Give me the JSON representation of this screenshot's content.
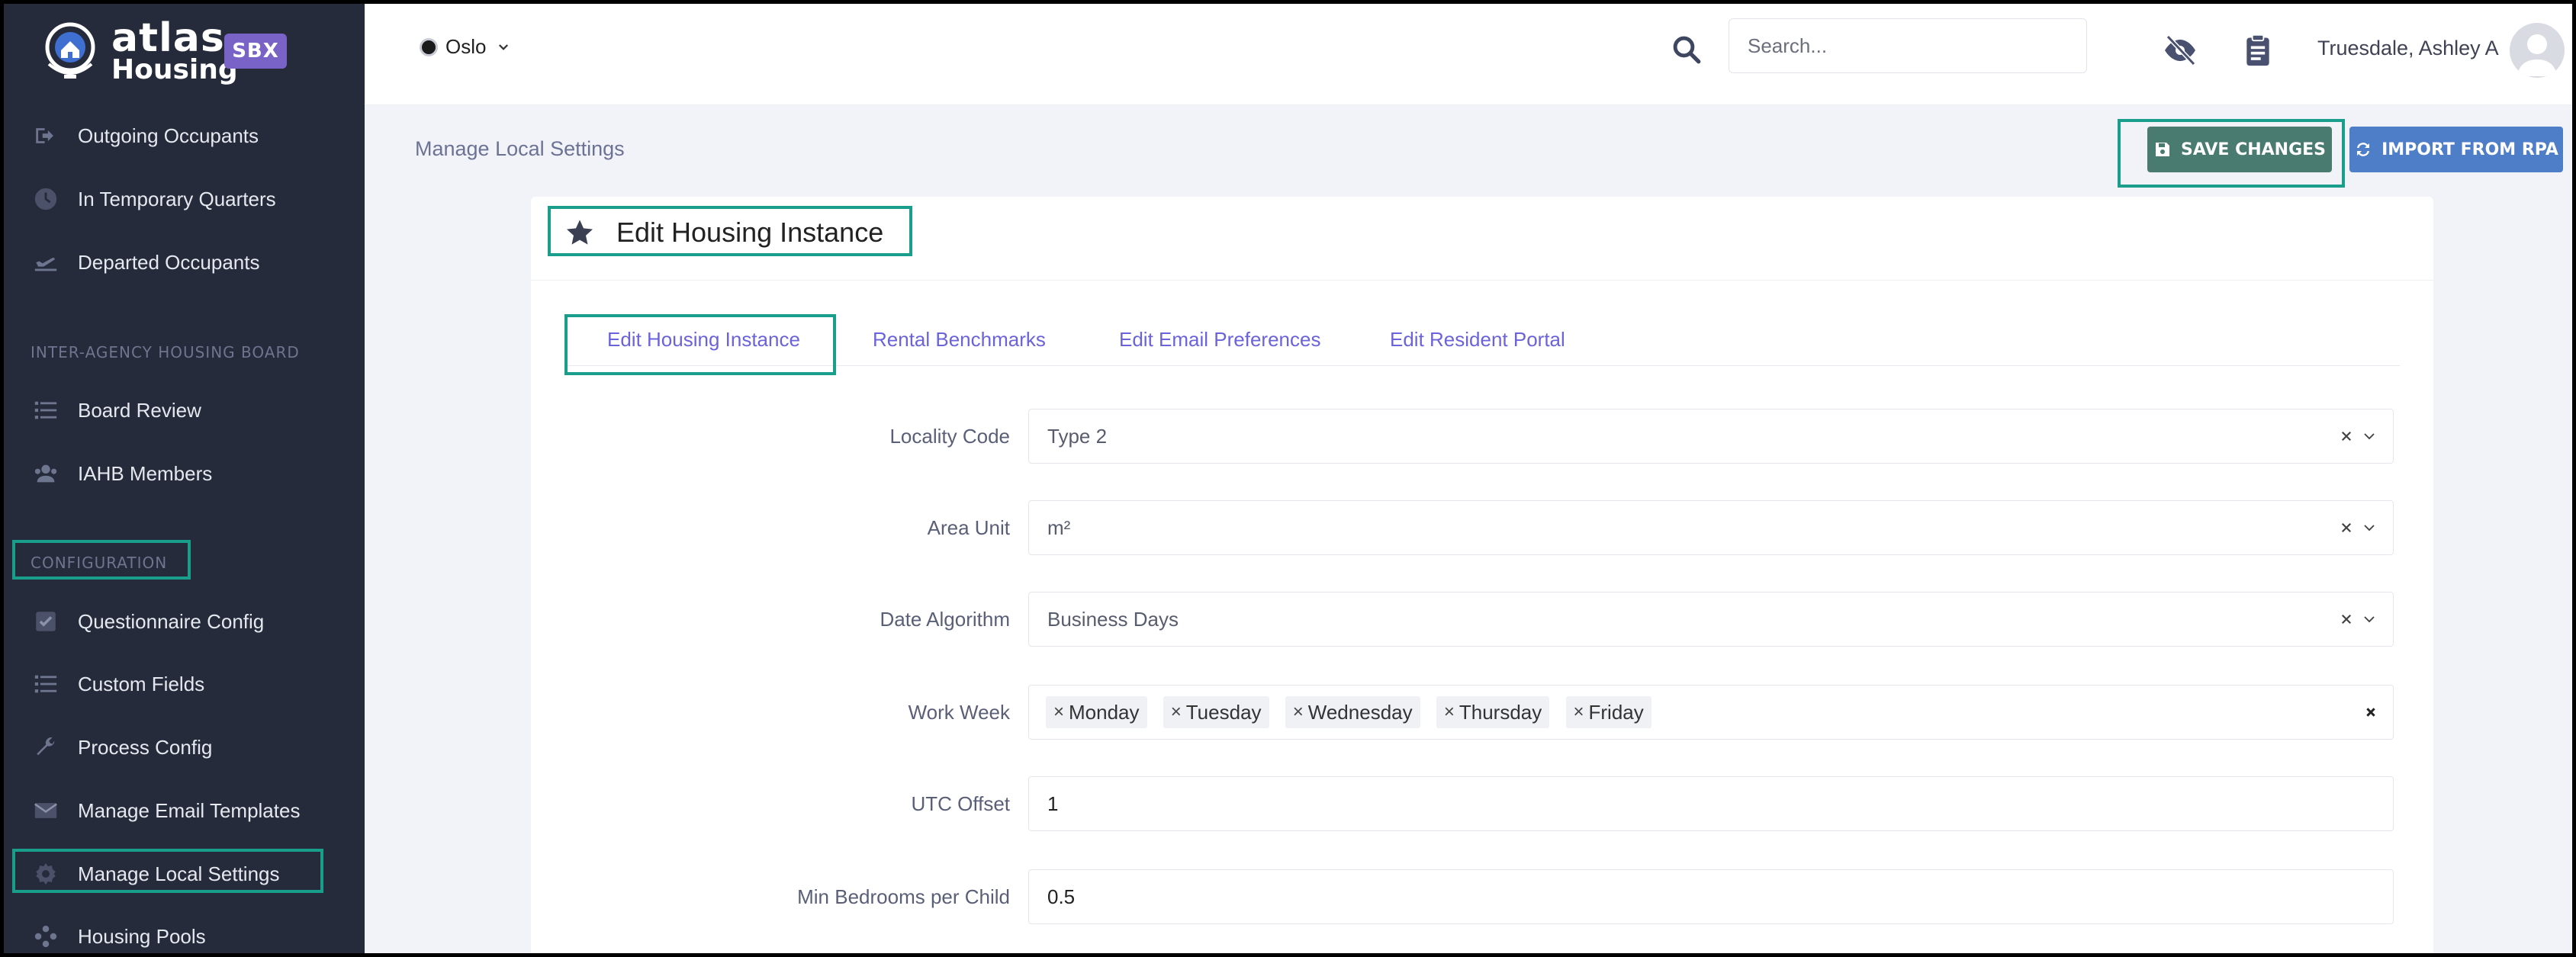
{
  "brand": {
    "name_line1": "atlas",
    "name_line2": "Housing",
    "env_badge": "SBX"
  },
  "sidebar": {
    "items_top": [
      {
        "label": "Outgoing Occupants",
        "icon": "sign-out-icon"
      },
      {
        "label": "In Temporary Quarters",
        "icon": "clock-icon"
      },
      {
        "label": "Departed Occupants",
        "icon": "plane-departure-icon"
      }
    ],
    "section_iahb": "INTER-AGENCY HOUSING BOARD",
    "items_iahb": [
      {
        "label": "Board Review",
        "icon": "list-icon"
      },
      {
        "label": "IAHB Members",
        "icon": "users-icon"
      }
    ],
    "section_config": "CONFIGURATION",
    "items_config": [
      {
        "label": "Questionnaire Config",
        "icon": "checkbox-icon"
      },
      {
        "label": "Custom Fields",
        "icon": "list-icon"
      },
      {
        "label": "Process Config",
        "icon": "wrench-icon"
      },
      {
        "label": "Manage Email Templates",
        "icon": "envelope-icon"
      },
      {
        "label": "Manage Local Settings",
        "icon": "gear-icon"
      },
      {
        "label": "Housing Pools",
        "icon": "cubes-icon"
      }
    ]
  },
  "topbar": {
    "city": "Oslo",
    "search_placeholder": "Search...",
    "user_name": "Truesdale, Ashley A"
  },
  "breadcrumb": "Manage Local Settings",
  "actions": {
    "save_label": "SAVE CHANGES",
    "import_label": "IMPORT FROM RPA"
  },
  "card": {
    "title": "Edit Housing Instance"
  },
  "tabs": [
    {
      "label": "Edit Housing Instance",
      "active": true
    },
    {
      "label": "Rental Benchmarks",
      "active": false
    },
    {
      "label": "Edit Email Preferences",
      "active": false
    },
    {
      "label": "Edit Resident Portal",
      "active": false
    }
  ],
  "form": {
    "locality_code": {
      "label": "Locality Code",
      "value": "Type 2"
    },
    "area_unit": {
      "label": "Area Unit",
      "value": "m²"
    },
    "date_algorithm": {
      "label": "Date Algorithm",
      "value": "Business Days"
    },
    "work_week": {
      "label": "Work Week",
      "days": [
        "Monday",
        "Tuesday",
        "Wednesday",
        "Thursday",
        "Friday"
      ]
    },
    "utc_offset": {
      "label": "UTC Offset",
      "value": "1"
    },
    "min_bedrooms": {
      "label": "Min Bedrooms per Child",
      "value": "0.5"
    }
  },
  "colors": {
    "sidebar_bg": "#262b3b",
    "accent_purple": "#7a63c7",
    "highlight_teal": "#1a9e8c",
    "save_button": "#4a7b71",
    "import_button": "#4f7ec9",
    "tab_text": "#6a63d9"
  }
}
